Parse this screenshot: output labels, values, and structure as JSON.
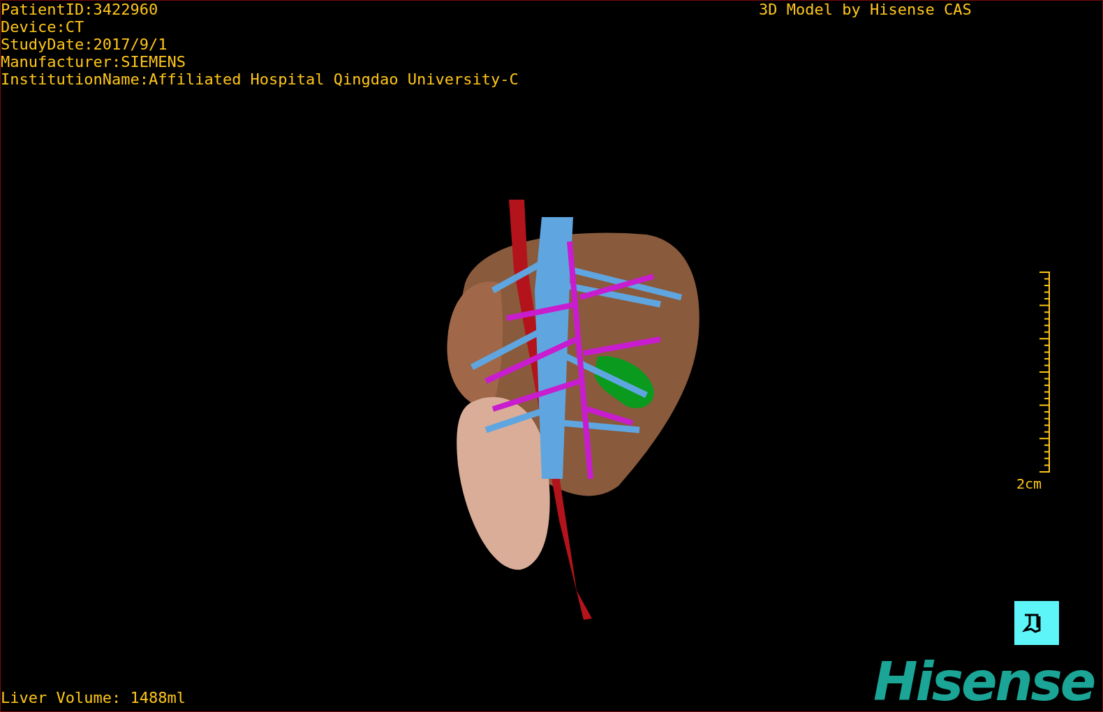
{
  "study_info": [
    "PatientID:3422960",
    "Device:CT",
    "StudyDate:2017/9/1",
    "Manufacturer:SIEMENS",
    "InstitutionName:Affiliated Hospital Qingdao University-C"
  ],
  "caption": "3D Model by Hisense CAS",
  "scale_bar": {
    "label": "2cm"
  },
  "measurement": "Liver Volume: 1488ml",
  "logo": "Hisense"
}
